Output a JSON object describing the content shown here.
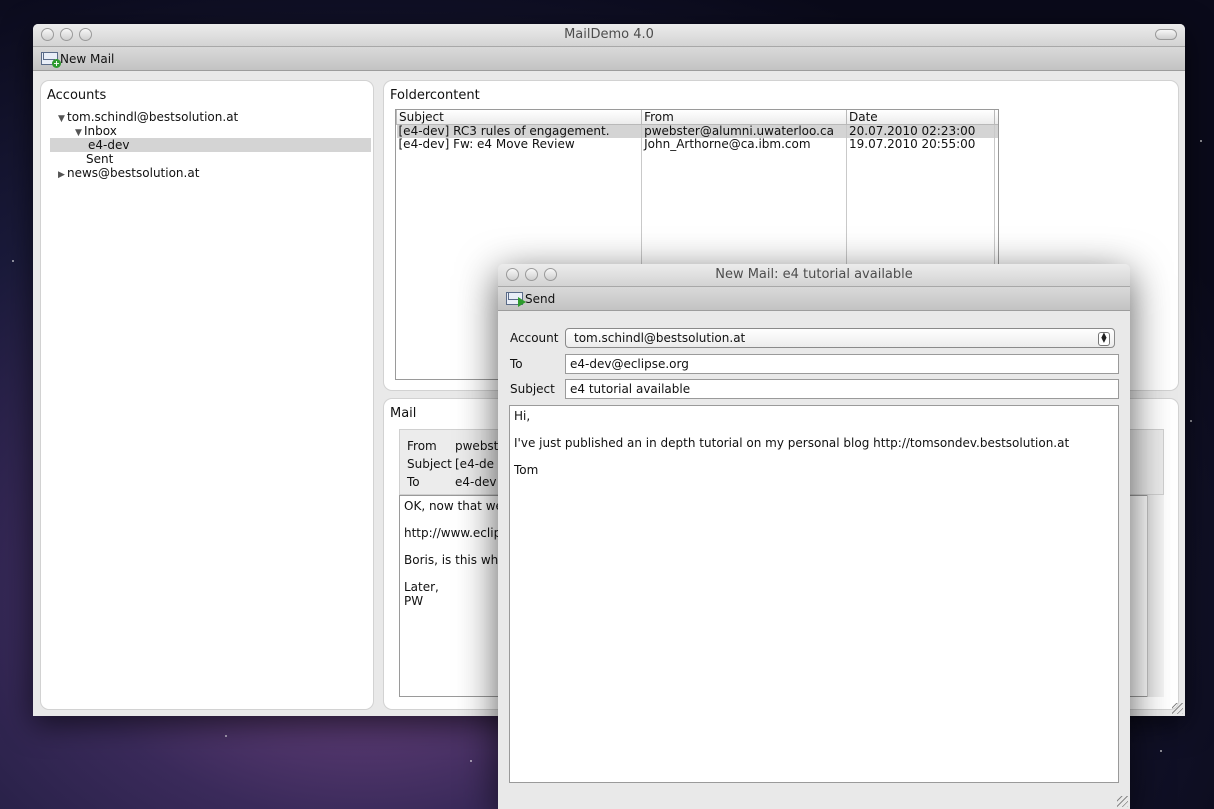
{
  "main_window": {
    "title": "MailDemo 4.0",
    "toolbar": {
      "new_mail_label": "New Mail"
    }
  },
  "accounts": {
    "title": "Accounts",
    "tree": [
      {
        "label": "tom.schindl@bestsolution.at",
        "expanded": true,
        "level": 0
      },
      {
        "label": "Inbox",
        "expanded": true,
        "level": 1
      },
      {
        "label": "e4-dev",
        "level": 2,
        "selected": true
      },
      {
        "label": "Sent",
        "level": 1
      },
      {
        "label": "news@bestsolution.at",
        "expanded": false,
        "level": 0
      }
    ]
  },
  "folder": {
    "title": "Foldercontent",
    "columns": [
      "Subject",
      "From",
      "Date",
      ""
    ],
    "rows": [
      {
        "subject": "[e4-dev] RC3 rules of engagement.",
        "from": "pwebster@alumni.uwaterloo.ca",
        "date": "20.07.2010 02:23:00",
        "selected": true
      },
      {
        "subject": "[e4-dev] Fw: e4 Move Review",
        "from": "John_Arthorne@ca.ibm.com",
        "date": "19.07.2010 20:55:00",
        "selected": false
      }
    ]
  },
  "mail": {
    "title": "Mail",
    "from_label": "From",
    "from_value": "pwebst",
    "subject_label": "Subject",
    "subject_value": "[e4-de",
    "to_label": "To",
    "to_value": "e4-dev",
    "body": [
      "OK, now that we",
      "http://www.eclip",
      "Boris, is this wha",
      "Later,",
      "PW"
    ]
  },
  "dialog": {
    "title": "New Mail: e4 tutorial available",
    "send_label": "Send",
    "account_label": "Account",
    "account_value": "tom.schindl@bestsolution.at",
    "to_label": "To",
    "to_value": "e4-dev@eclipse.org",
    "subject_label": "Subject",
    "subject_value": "e4 tutorial available",
    "body": [
      "Hi,",
      "I've just published an in depth tutorial on my personal blog http://tomsondev.bestsolution.at",
      "Tom"
    ]
  }
}
